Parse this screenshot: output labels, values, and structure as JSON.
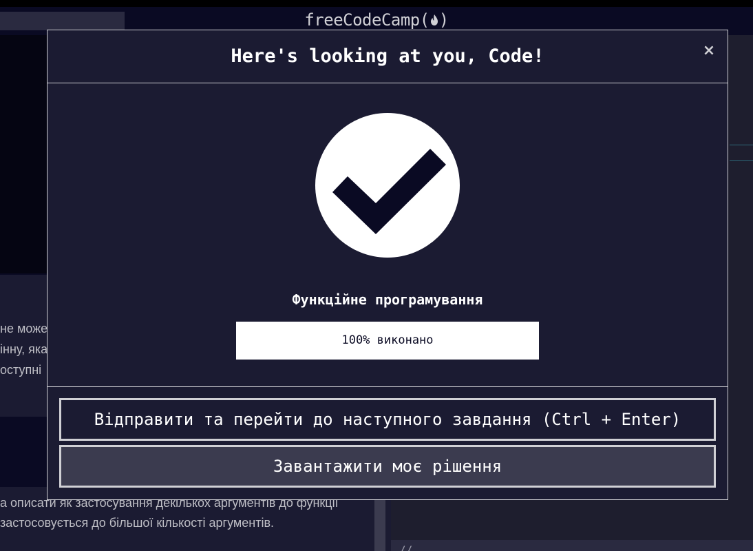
{
  "header": {
    "brand": "freeCodeCamp(",
    "brand_close": ")"
  },
  "background": {
    "desc_lines": [
      "не може",
      "інну, яка",
      "оступні"
    ],
    "desc_bottom_lines": [
      "а описати як застосування декількох аргументів до функції",
      "застосовується до більшої кількості аргументів."
    ],
    "code_snippet": "//"
  },
  "modal": {
    "title": "Here's looking at you, Code!",
    "close_label": "×",
    "certification": "Функційне програмування",
    "progress_percent": 100,
    "progress_label": "100% виконано",
    "submit_button": "Відправити та перейти до наступного завдання (Ctrl + Enter)",
    "download_button": "Завантажити моє рішення"
  },
  "colors": {
    "check_circle": "#ffffff",
    "check_mark": "#0a0a23",
    "modal_bg": "#1b1b32",
    "border": "#d0d0d5"
  },
  "icons": {
    "success": "checkmark-circle-icon",
    "brand": "flame-icon",
    "close": "close-icon"
  }
}
